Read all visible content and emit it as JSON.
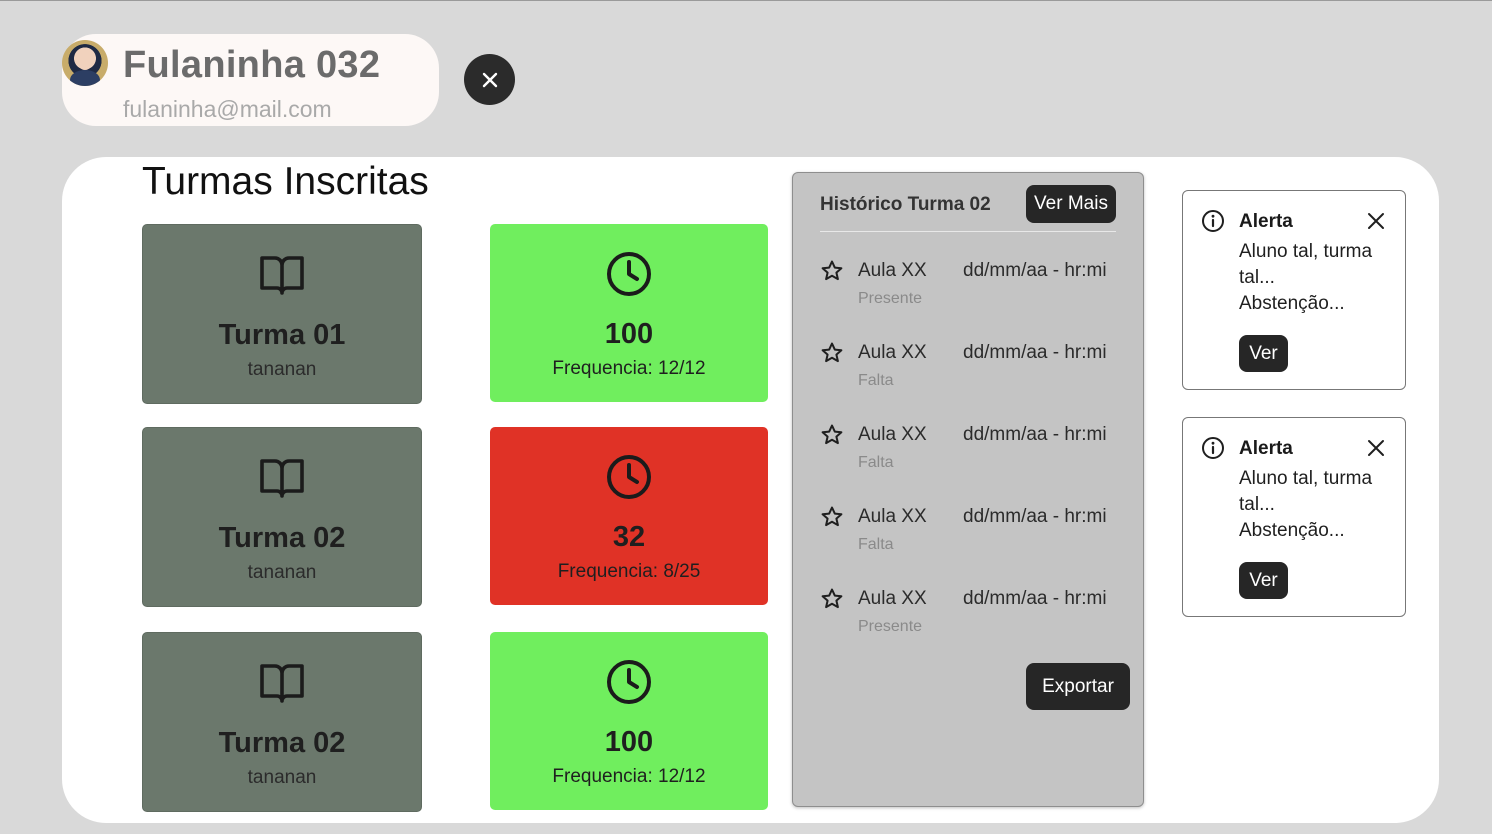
{
  "profile": {
    "name": "Fulaninha 032",
    "email": "fulaninha@mail.com"
  },
  "page": {
    "title": "Turmas Inscritas"
  },
  "classes": [
    {
      "name": "Turma 01",
      "subtitle": "tananan",
      "score": "100",
      "frequency": "Frequencia: 12/12",
      "status": "good"
    },
    {
      "name": "Turma 02",
      "subtitle": "tananan",
      "score": "32",
      "frequency": "Frequencia: 8/25",
      "status": "bad"
    },
    {
      "name": "Turma 02",
      "subtitle": "tananan",
      "score": "100",
      "frequency": "Frequencia: 12/12",
      "status": "good"
    }
  ],
  "history": {
    "title": "Histórico Turma 02",
    "more_label": "Ver Mais",
    "export_label": "Exportar",
    "items": [
      {
        "label": "Aula XX",
        "datetime": "dd/mm/aa - hr:mi",
        "status": "Presente"
      },
      {
        "label": "Aula XX",
        "datetime": "dd/mm/aa - hr:mi",
        "status": "Falta"
      },
      {
        "label": "Aula XX",
        "datetime": "dd/mm/aa - hr:mi",
        "status": "Falta"
      },
      {
        "label": "Aula XX",
        "datetime": "dd/mm/aa - hr:mi",
        "status": "Falta"
      },
      {
        "label": "Aula XX",
        "datetime": "dd/mm/aa - hr:mi",
        "status": "Presente"
      }
    ]
  },
  "alerts": [
    {
      "title": "Alerta",
      "line1": "Aluno tal, turma",
      "line2": "tal...",
      "line3": "Abstenção...",
      "button": "Ver"
    },
    {
      "title": "Alerta",
      "line1": "Aluno tal, turma",
      "line2": "tal...",
      "line3": "Abstenção...",
      "button": "Ver"
    }
  ],
  "colors": {
    "good": "#70ee5e",
    "bad": "#e03226",
    "class_card": "#6b786c",
    "dark_button": "#262626"
  },
  "icons": {
    "class": "book-open-icon",
    "frequency": "clock-icon",
    "history_item": "star-icon",
    "alert": "info-icon",
    "close": "close-icon"
  }
}
